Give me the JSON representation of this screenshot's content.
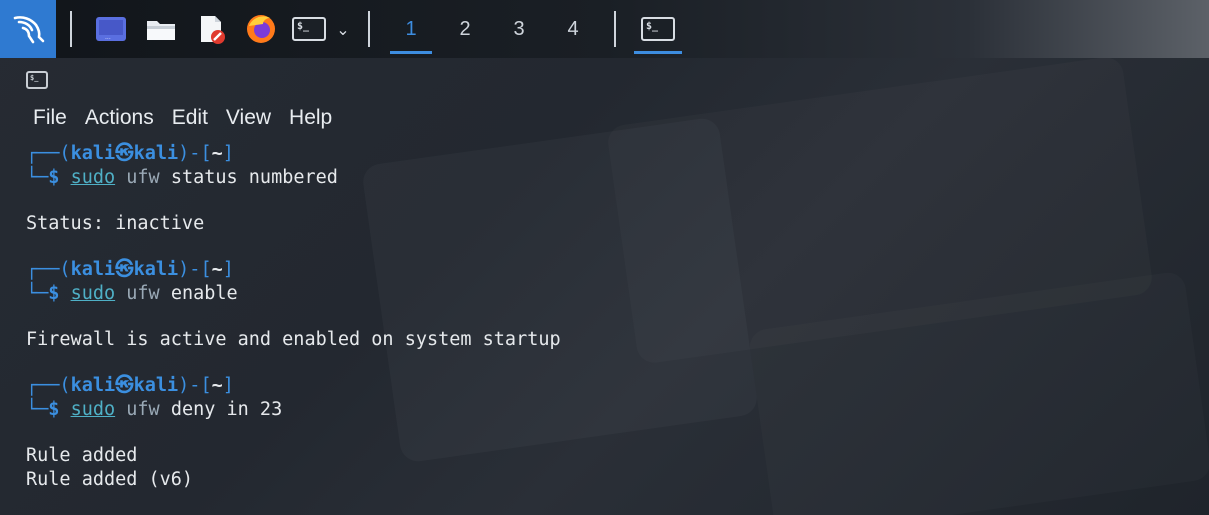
{
  "panel": {
    "workspaces": [
      "1",
      "2",
      "3",
      "4"
    ],
    "active_workspace": "1",
    "launcher_terminal_label": "$_",
    "task_terminal_label": "$_"
  },
  "window": {
    "icon_label": "$_",
    "menu": [
      "File",
      "Actions",
      "Edit",
      "View",
      "Help"
    ]
  },
  "terminal": {
    "prompt": {
      "open": "┌──(",
      "user": "kali㉿kali",
      "mid": ")-[",
      "dir": "~",
      "close": "]",
      "corner": "└─",
      "symbol": "$"
    },
    "blocks": [
      {
        "cmd_sudo": "sudo",
        "cmd_prog": "ufw",
        "cmd_args": "status numbered",
        "output": [
          "Status: inactive"
        ]
      },
      {
        "cmd_sudo": "sudo",
        "cmd_prog": "ufw",
        "cmd_args": "enable",
        "output": [
          "Firewall is active and enabled on system startup"
        ]
      },
      {
        "cmd_sudo": "sudo",
        "cmd_prog": "ufw",
        "cmd_args": "deny in 23",
        "output": [
          "Rule added",
          "Rule added (v6)"
        ]
      }
    ]
  },
  "colors": {
    "accent": "#3b8fe0",
    "panel_bg": "#11151a",
    "terminal_bg": "#262b33",
    "text": "#e6e9ec"
  }
}
